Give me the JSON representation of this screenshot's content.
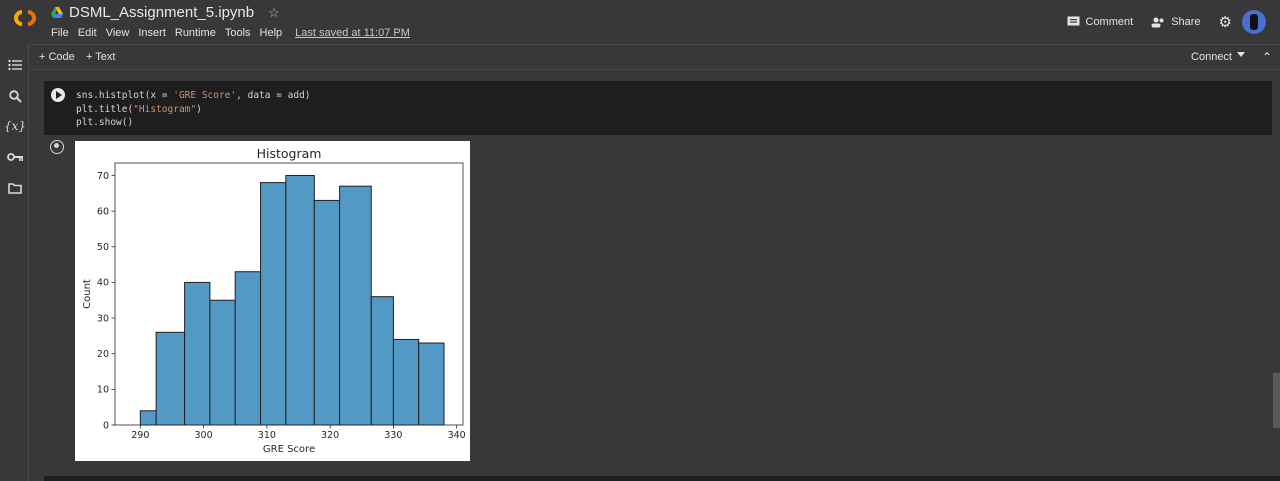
{
  "header": {
    "notebook_title": "DSML_Assignment_5.ipynb",
    "menu": [
      "File",
      "Edit",
      "View",
      "Insert",
      "Runtime",
      "Tools",
      "Help"
    ],
    "last_saved": "Last saved at 11:07 PM",
    "comment_label": "Comment",
    "share_label": "Share"
  },
  "toolbar": {
    "code_label": "+ Code",
    "text_label": "+ Text",
    "connect_label": "Connect"
  },
  "sidebar": {
    "icons": [
      "table-of-contents-icon",
      "search-icon",
      "variables-icon",
      "secrets-key-icon",
      "files-folder-icon"
    ],
    "variables_glyph": "{x}"
  },
  "cell": {
    "lines": [
      [
        "sns.histplot(x = ",
        "'GRE Score'",
        ", data = add)"
      ],
      [
        "plt.title(",
        "\"Histogram\"",
        ")"
      ],
      [
        "plt.show()",
        "",
        ""
      ]
    ]
  },
  "chart_data": {
    "type": "bar",
    "title": "Histogram",
    "xlabel": "GRE Score",
    "ylabel": "Count",
    "bins": [
      [
        290,
        292.5,
        4
      ],
      [
        292.5,
        297,
        26
      ],
      [
        297,
        301,
        40
      ],
      [
        301,
        305,
        35
      ],
      [
        305,
        309,
        43
      ],
      [
        309,
        313,
        68
      ],
      [
        313,
        317.5,
        70
      ],
      [
        317.5,
        321.5,
        63
      ],
      [
        321.5,
        326.5,
        67
      ],
      [
        326.5,
        330,
        36
      ],
      [
        330,
        334,
        24
      ],
      [
        334,
        338,
        23
      ]
    ],
    "xticks": [
      290,
      300,
      310,
      320,
      330,
      340
    ],
    "yticks": [
      0,
      10,
      20,
      30,
      40,
      50,
      60,
      70
    ],
    "xlim": [
      286,
      341
    ],
    "ylim": [
      0,
      73.5
    ],
    "bar_color": "#5399c6",
    "edge_color": "#1f1f1f"
  }
}
